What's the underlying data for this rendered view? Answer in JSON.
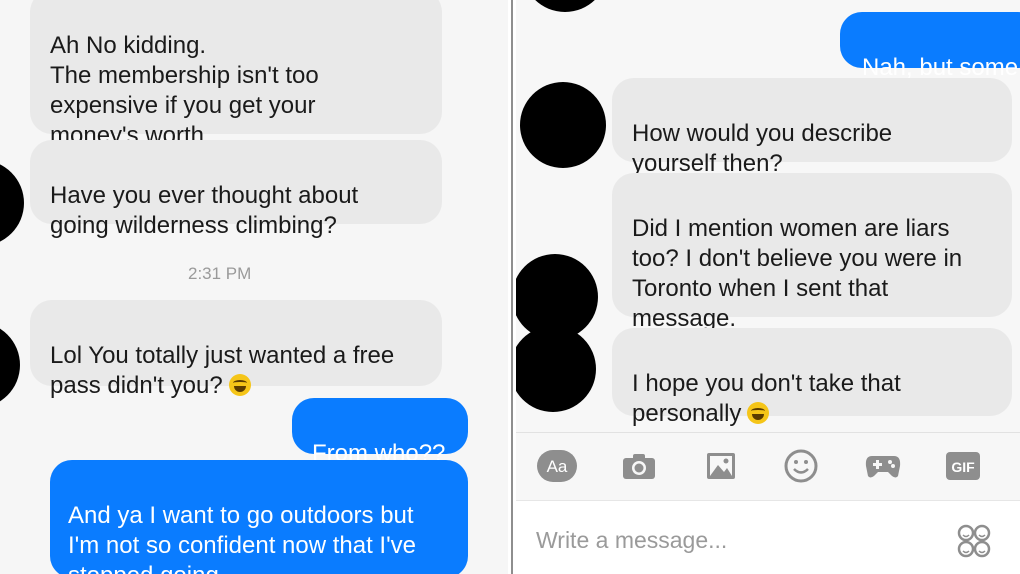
{
  "left_thread": {
    "msg1": "Ah No kidding.\nThe membership isn't too\nexpensive if you get your\nmoney's worth.",
    "msg2": "Have you ever thought about\ngoing wilderness climbing?",
    "timestamp": "2:31 PM",
    "msg3": "Lol You totally just wanted a free\npass didn't you?",
    "msg3_emoji": "face-with-tears-of-joy-emoji",
    "sent1": "From who??",
    "sent2": "And ya I want to go outdoors but\nI'm not so confident now that I've\nstopped going"
  },
  "right_thread": {
    "sent1": "Nah, but some",
    "msg1": "How would you describe\nyourself then?",
    "msg2": "Did I mention women are liars\ntoo?  I don't believe you were in\nToronto when I sent that\nmessage.",
    "msg3": "I hope you don't take that\npersonally",
    "msg3_emoji": "face-with-tears-of-joy-emoji"
  },
  "toolbar": {
    "text_button": "Aa",
    "gif_button": "GIF",
    "icons": [
      "camera-icon",
      "image-icon",
      "emoji-icon",
      "game-controller-icon"
    ]
  },
  "composer": {
    "placeholder": "Write a message..."
  },
  "colors": {
    "incoming_bubble": "#e9e9e9",
    "outgoing_bubble": "#0a7cff",
    "icon_gray": "#8e8e8e"
  }
}
